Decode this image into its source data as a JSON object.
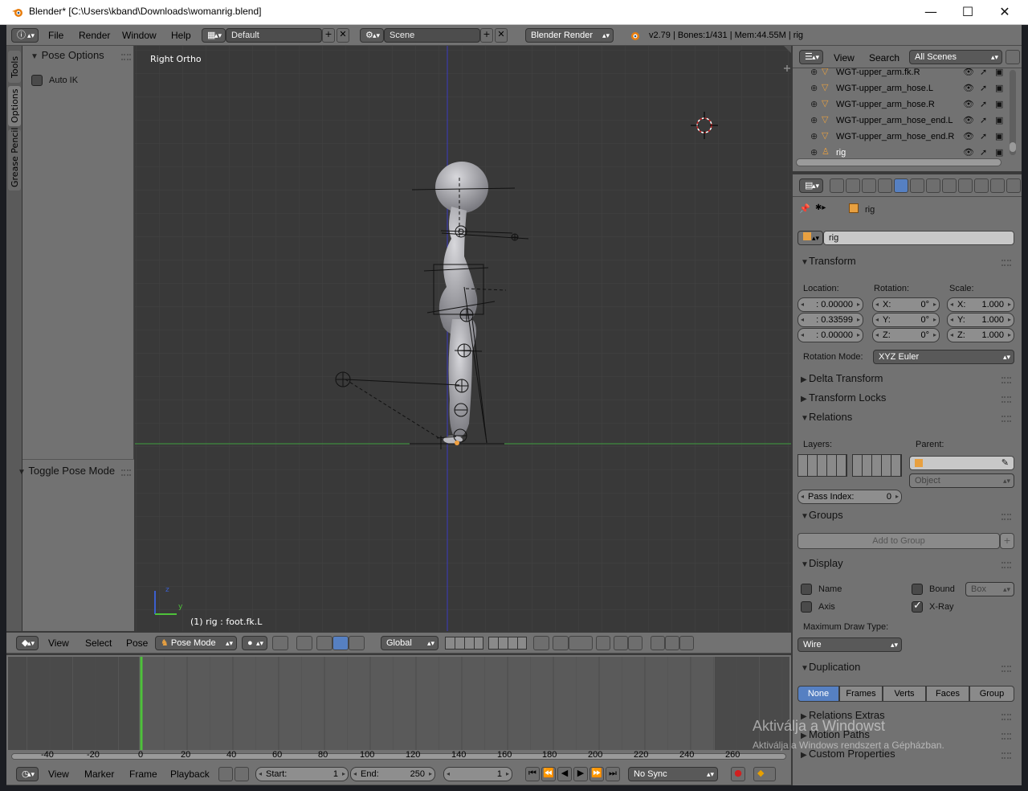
{
  "window": {
    "title": "Blender* [C:\\Users\\kband\\Downloads\\womanrig.blend]",
    "minimize": "—",
    "maximize": "☐",
    "close": "✕"
  },
  "info_header": {
    "menus": [
      "File",
      "Render",
      "Window",
      "Help"
    ],
    "screen_layout": "Default",
    "scene": "Scene",
    "render_engine": "Blender Render",
    "stats": "v2.79 | Bones:1/431 | Mem:44.55M | rig"
  },
  "toolshelf": {
    "tabs": [
      "Tools",
      "Options",
      "Grease Pencil"
    ],
    "pose_options": {
      "title": "Pose Options",
      "auto_ik_label": "Auto IK",
      "auto_ik": false
    },
    "operator_panel_title": "Toggle Pose Mode"
  },
  "viewport": {
    "view_name": "Right Ortho",
    "selection_info": "(1) rig : foot.fk.L",
    "axis_z": "z",
    "axis_y": "y",
    "header": {
      "menus": [
        "View",
        "Select",
        "Pose"
      ],
      "mode": "Pose Mode",
      "orientation": "Global"
    }
  },
  "outliner": {
    "menus": [
      "View",
      "Search"
    ],
    "filter": "All Scenes",
    "rows": [
      {
        "name": "WGT-upper_arm.fk.R"
      },
      {
        "name": "WGT-upper_arm_hose.L"
      },
      {
        "name": "WGT-upper_arm_hose.R"
      },
      {
        "name": "WGT-upper_arm_hose_end.L"
      },
      {
        "name": "WGT-upper_arm_hose_end.R"
      },
      {
        "name": "rig"
      }
    ]
  },
  "properties": {
    "breadcrumb": "rig",
    "object_name": "rig",
    "transform": {
      "title": "Transform",
      "location_label": "Location:",
      "rotation_label": "Rotation:",
      "scale_label": "Scale:",
      "location": [
        ": 0.00000",
        ": 0.33599",
        ": 0.00000"
      ],
      "rotation": [
        {
          "axis": "X:",
          "value": "0°"
        },
        {
          "axis": "Y:",
          "value": "0°"
        },
        {
          "axis": "Z:",
          "value": "0°"
        }
      ],
      "scale": [
        {
          "axis": "X:",
          "value": "1.000"
        },
        {
          "axis": "Y:",
          "value": "1.000"
        },
        {
          "axis": "Z:",
          "value": "1.000"
        }
      ],
      "rotation_mode_label": "Rotation Mode:",
      "rotation_mode": "XYZ Euler"
    },
    "delta_transform": "Delta Transform",
    "transform_locks": "Transform Locks",
    "relations": {
      "title": "Relations",
      "layers_label": "Layers:",
      "parent_label": "Parent:",
      "parent_type": "Object",
      "pass_index_label": "Pass Index:",
      "pass_index": "0"
    },
    "groups": {
      "title": "Groups",
      "add_label": "Add to Group"
    },
    "display": {
      "title": "Display",
      "name_label": "Name",
      "name": false,
      "bound_label": "Bound",
      "bound": false,
      "bound_type": "Box",
      "axis_label": "Axis",
      "axis": false,
      "xray_label": "X-Ray",
      "xray": true,
      "max_draw_type_label": "Maximum Draw Type:",
      "max_draw_type": "Wire"
    },
    "duplication": {
      "title": "Duplication",
      "options": [
        "None",
        "Frames",
        "Verts",
        "Faces",
        "Group"
      ],
      "selected": "None"
    },
    "relations_extras": "Relations Extras",
    "motion_paths": "Motion Paths",
    "custom_properties": "Custom Properties"
  },
  "timeline": {
    "ticks": [
      "-40",
      "-20",
      "0",
      "20",
      "40",
      "60",
      "80",
      "100",
      "120",
      "140",
      "160",
      "180",
      "200",
      "220",
      "240",
      "260"
    ],
    "current_frame": 1,
    "menus": [
      "View",
      "Marker",
      "Frame",
      "Playback"
    ],
    "start_label": "Start:",
    "start": "1",
    "end_label": "End:",
    "end": "250",
    "frame": "1",
    "sync": "No Sync"
  },
  "watermark": {
    "line1": "Aktiválja a Windowst",
    "line2": "Aktiválja a Windows rendszert a Gépházban."
  },
  "colors": {
    "selected": "#5680c2",
    "header": "#727272",
    "panel": "#727272",
    "viewport": "#393939",
    "playhead": "#4ec23a"
  }
}
